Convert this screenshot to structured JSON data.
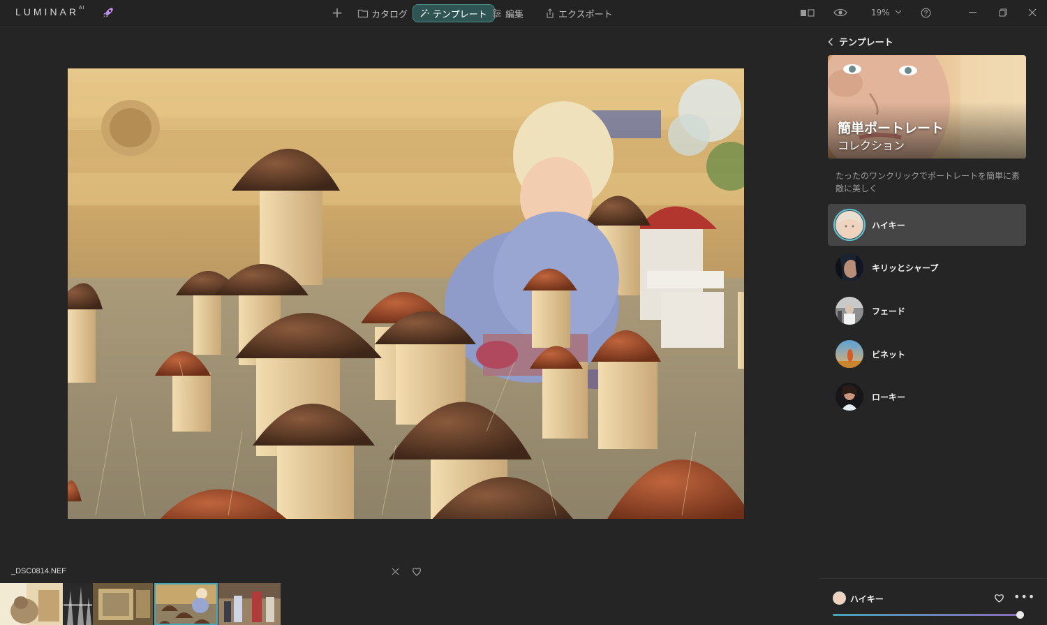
{
  "app": {
    "logo_text": "LUMINAR",
    "logo_sup": "AI"
  },
  "nav": {
    "catalog": "カタログ",
    "templates": "テンプレート",
    "edit": "編集",
    "export": "エクスポート"
  },
  "toolbar": {
    "zoom": "19%"
  },
  "filmstrip": {
    "filename": "_DSC0814.NEF",
    "selected_index": 3
  },
  "panel": {
    "back_label": "テンプレート",
    "banner_title": "簡単ポートレート",
    "banner_subtitle": "コレクション",
    "description": "たったのワンクリックでポートレートを簡単に素敵に美しく",
    "presets": [
      {
        "label": "ハイキー",
        "active": true
      },
      {
        "label": "キリッとシャープ",
        "active": false
      },
      {
        "label": "フェード",
        "active": false
      },
      {
        "label": "ビネット",
        "active": false
      },
      {
        "label": "ローキー",
        "active": false
      }
    ],
    "footer": {
      "preset_label": "ハイキー",
      "amount": 1.0
    }
  },
  "colors": {
    "accent": "#45a7b8",
    "active_tab_bg": "#2f5454",
    "background": "#252525"
  }
}
